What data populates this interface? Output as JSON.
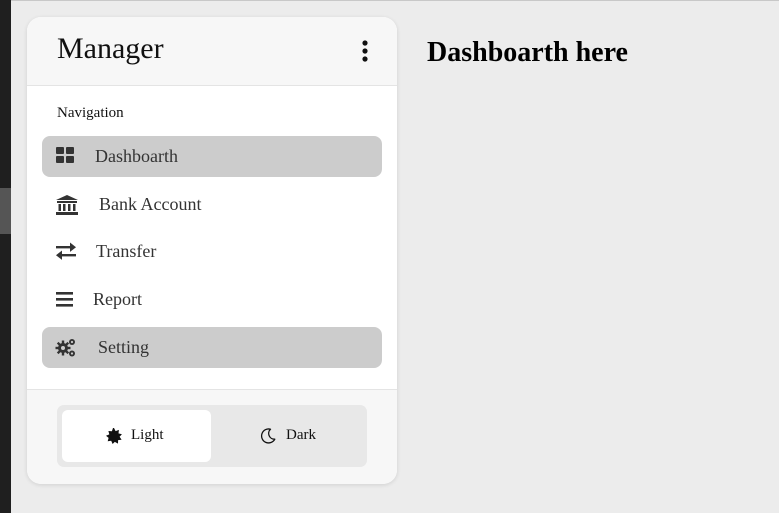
{
  "sidebar": {
    "title": "Manager",
    "menu_icon": "more-vertical-icon",
    "nav_label": "Navigation",
    "items": [
      {
        "label": "Dashboarth",
        "icon": "grid-icon",
        "active": true
      },
      {
        "label": "Bank Account",
        "icon": "bank-icon",
        "active": false
      },
      {
        "label": "Transfer",
        "icon": "transfer-icon",
        "active": false
      },
      {
        "label": "Report",
        "icon": "list-icon",
        "active": false
      },
      {
        "label": "Setting",
        "icon": "gears-icon",
        "active": true
      }
    ],
    "theme": {
      "light_label": "Light",
      "dark_label": "Dark",
      "selected": "Light"
    }
  },
  "main": {
    "title": "Dashboarth here"
  },
  "colors": {
    "background": "#ececec",
    "sidebar": "#ffffff",
    "active_item": "#cccccc",
    "icon": "#333333"
  }
}
